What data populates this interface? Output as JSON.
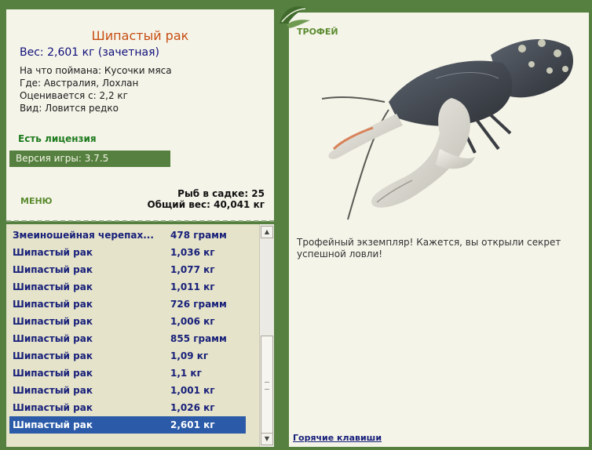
{
  "info": {
    "fish_name": "Шипастый рак",
    "weight": "Вес: 2,601 кг (зачетная)",
    "bait": "На что поймана: Кусочки мяса",
    "location": "Где: Австралия, Лохлан",
    "value": "Оценивается с: 2,2 кг",
    "kind": "Вид: Ловится редко",
    "license": "Есть лицензия",
    "version": "Версия игры: 3.7.5"
  },
  "menu": {
    "label": "МЕНЮ",
    "fish_count": "Рыб в садке: 25",
    "total_weight": "Общий вес: 40,041 кг"
  },
  "catch_list": [
    {
      "name": "Змеиношейная черепах...",
      "weight": "478 грамм"
    },
    {
      "name": "Шипастый рак",
      "weight": "1,036 кг"
    },
    {
      "name": "Шипастый рак",
      "weight": "1,077 кг"
    },
    {
      "name": "Шипастый рак",
      "weight": "1,011 кг"
    },
    {
      "name": "Шипастый рак",
      "weight": "726 грамм"
    },
    {
      "name": "Шипастый рак",
      "weight": "1,006 кг"
    },
    {
      "name": "Шипастый рак",
      "weight": "855 грамм"
    },
    {
      "name": "Шипастый рак",
      "weight": "1,09 кг"
    },
    {
      "name": "Шипастый рак",
      "weight": "1,1 кг"
    },
    {
      "name": "Шипастый рак",
      "weight": "1,001 кг"
    },
    {
      "name": "Шипастый рак",
      "weight": "1,026 кг"
    },
    {
      "name": "Шипастый рак",
      "weight": "2,601 кг",
      "selected": true
    }
  ],
  "trophy": {
    "label": "ТРОФЕЙ",
    "message": "Трофейный экземпляр! Кажется, вы открыли секрет успешной ловли!",
    "hotkeys": "Горячие клавиши"
  },
  "colors": {
    "frame_green": "#55803f",
    "panel_bg": "#f5f4e9",
    "list_bg": "#e5e3c9",
    "selection": "#2b5aa8",
    "list_text": "#18207a",
    "title_orange": "#c64d12"
  },
  "icons": [
    "leaf-ornament-icon",
    "crayfish-trophy-image",
    "scroll-up-arrow-icon",
    "scroll-down-arrow-icon"
  ]
}
